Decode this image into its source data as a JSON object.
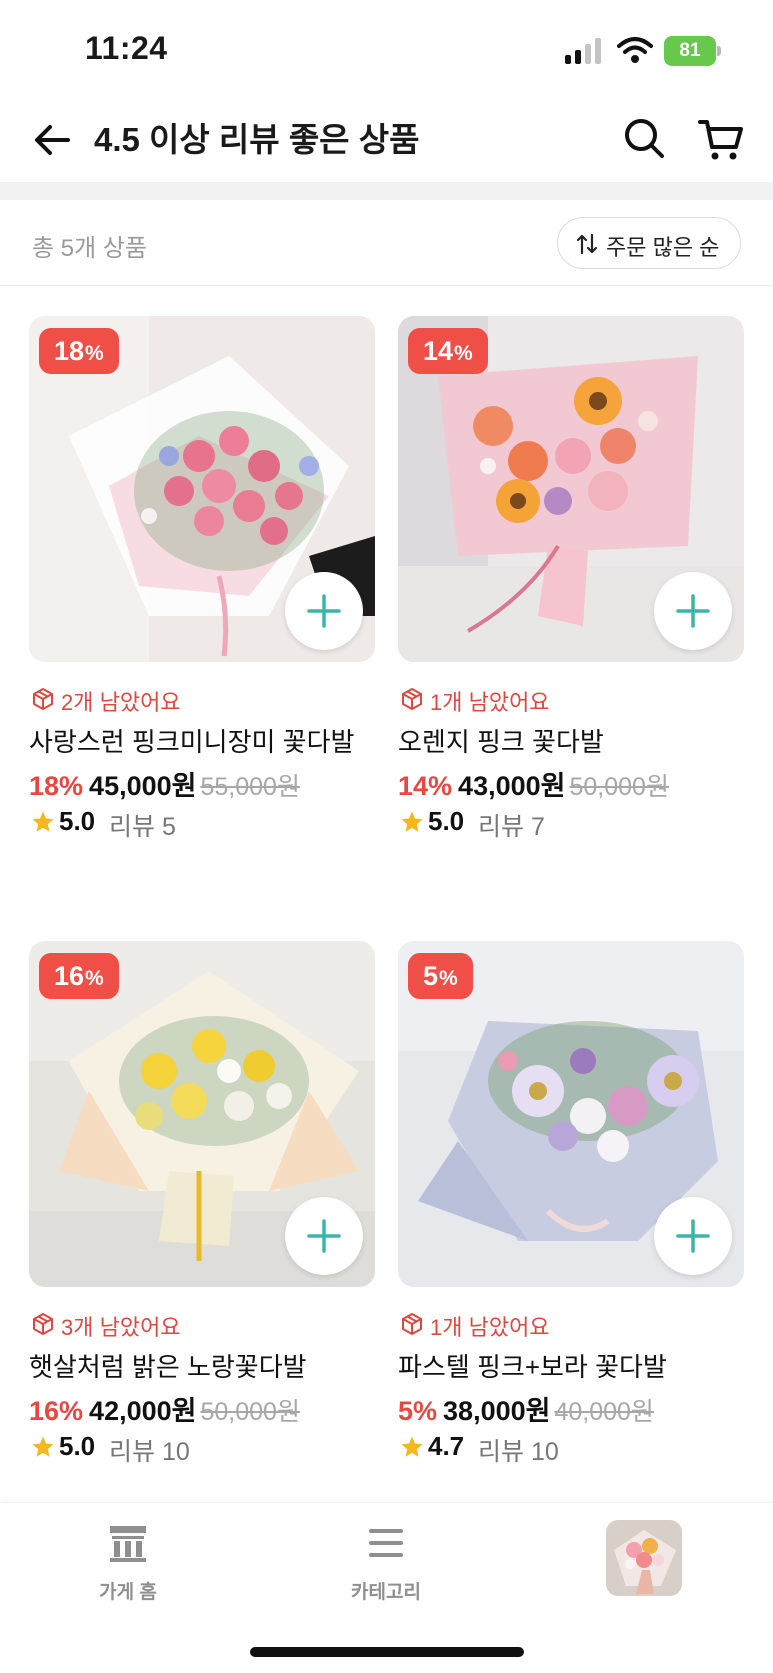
{
  "status_bar": {
    "time": "11:24",
    "battery": "81"
  },
  "header": {
    "title": "4.5 이상 리뷰 좋은 상품"
  },
  "filter": {
    "total": "총 5개 상품",
    "sort_label": "주문 많은 순"
  },
  "products": [
    {
      "discount": "18",
      "percent_sign": "%",
      "stock": "2개 남았어요",
      "name": "사랑스런 핑크미니장미 꽃다발",
      "discount_label": "18%",
      "price": "45,000원",
      "original_price": "55,000원",
      "rating": "5.0",
      "reviews": "리뷰 5"
    },
    {
      "discount": "14",
      "percent_sign": "%",
      "stock": "1개 남았어요",
      "name": "오렌지 핑크 꽃다발",
      "discount_label": "14%",
      "price": "43,000원",
      "original_price": "50,000원",
      "rating": "5.0",
      "reviews": "리뷰 7"
    },
    {
      "discount": "16",
      "percent_sign": "%",
      "stock": "3개 남았어요",
      "name": "햇살처럼 밝은 노랑꽃다발",
      "discount_label": "16%",
      "price": "42,000원",
      "original_price": "50,000원",
      "rating": "5.0",
      "reviews": "리뷰 10"
    },
    {
      "discount": "5",
      "percent_sign": "%",
      "stock": "1개 남았어요",
      "name": "파스텔 핑크+보라 꽃다발",
      "discount_label": "5%",
      "price": "38,000원",
      "original_price": "40,000원",
      "rating": "4.7",
      "reviews": "리뷰 10"
    }
  ],
  "bottom_nav": {
    "home": "가게 홈",
    "category": "카테고리"
  },
  "colors": {
    "accent_red": "#ef4f47",
    "teal_plus": "#3bb5a8",
    "star": "#f5b81c",
    "battery_green": "#66c94c"
  },
  "icons": [
    "back-arrow-icon",
    "search-icon",
    "cart-icon",
    "sort-icon",
    "box-icon",
    "star-icon",
    "plus-icon",
    "store-icon",
    "menu-icon"
  ]
}
